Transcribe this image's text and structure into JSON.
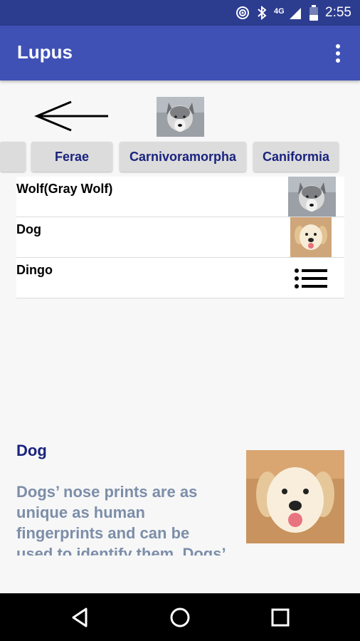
{
  "status_bar": {
    "time": "2:55",
    "network": "4G LTE"
  },
  "app_bar": {
    "title": "Lupus"
  },
  "breadcrumb": {
    "chips": [
      "Ferae",
      "Carnivoramorpha",
      "Caniformia"
    ]
  },
  "list": {
    "items": [
      {
        "label": "Wolf(Gray Wolf)",
        "icon": "wolf-image"
      },
      {
        "label": "Dog",
        "icon": "dog-image"
      },
      {
        "label": "Dingo",
        "icon": "list-icon"
      }
    ]
  },
  "detail": {
    "title": "Dog",
    "text": "Dogs’ nose prints are as unique as human fingerprints and can be used to identify them. Dogs’"
  },
  "colors": {
    "status_bar": "#2c3c8f",
    "app_bar": "#3f51b5",
    "chip_text": "#1a237e",
    "detail_text": "#7c8ea8"
  }
}
